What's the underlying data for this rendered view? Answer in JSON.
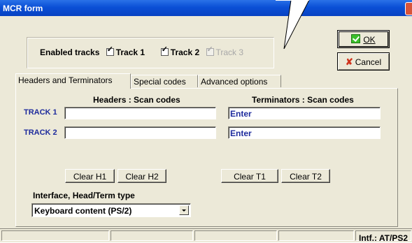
{
  "window": {
    "title": "MCR form"
  },
  "enabled_tracks": {
    "label": "Enabled tracks",
    "track1": {
      "label": "Track 1",
      "checked": true
    },
    "track2": {
      "label": "Track 2",
      "checked": true
    },
    "track3": {
      "label": "Track 3",
      "checked": true,
      "disabled": true
    }
  },
  "buttons": {
    "ok_label": "OK",
    "cancel_label": "Cancel"
  },
  "tabs": [
    {
      "label": "Headers and Terminators",
      "active": true
    },
    {
      "label": "Special codes"
    },
    {
      "label": "Advanced options"
    }
  ],
  "panel": {
    "headers_title": "Headers : Scan codes",
    "terminators_title": "Terminators : Scan codes",
    "track1_label": "TRACK 1",
    "track2_label": "TRACK 2",
    "track1_header": "",
    "track1_terminator": "Enter",
    "track2_header": "",
    "track2_terminator": "Enter",
    "clear_h1": "Clear H1",
    "clear_h2": "Clear H2",
    "clear_t1": "Clear T1",
    "clear_t2": "Clear T2",
    "interface_label": "Interface, Head/Term type",
    "interface_value": "Keyboard content (PS/2)"
  },
  "status": {
    "interface": "Intf.: AT/PS2"
  },
  "colors": {
    "titlebar": "#0a4fd6",
    "field_text": "#1d2a9c",
    "face": "#ece9d8"
  }
}
